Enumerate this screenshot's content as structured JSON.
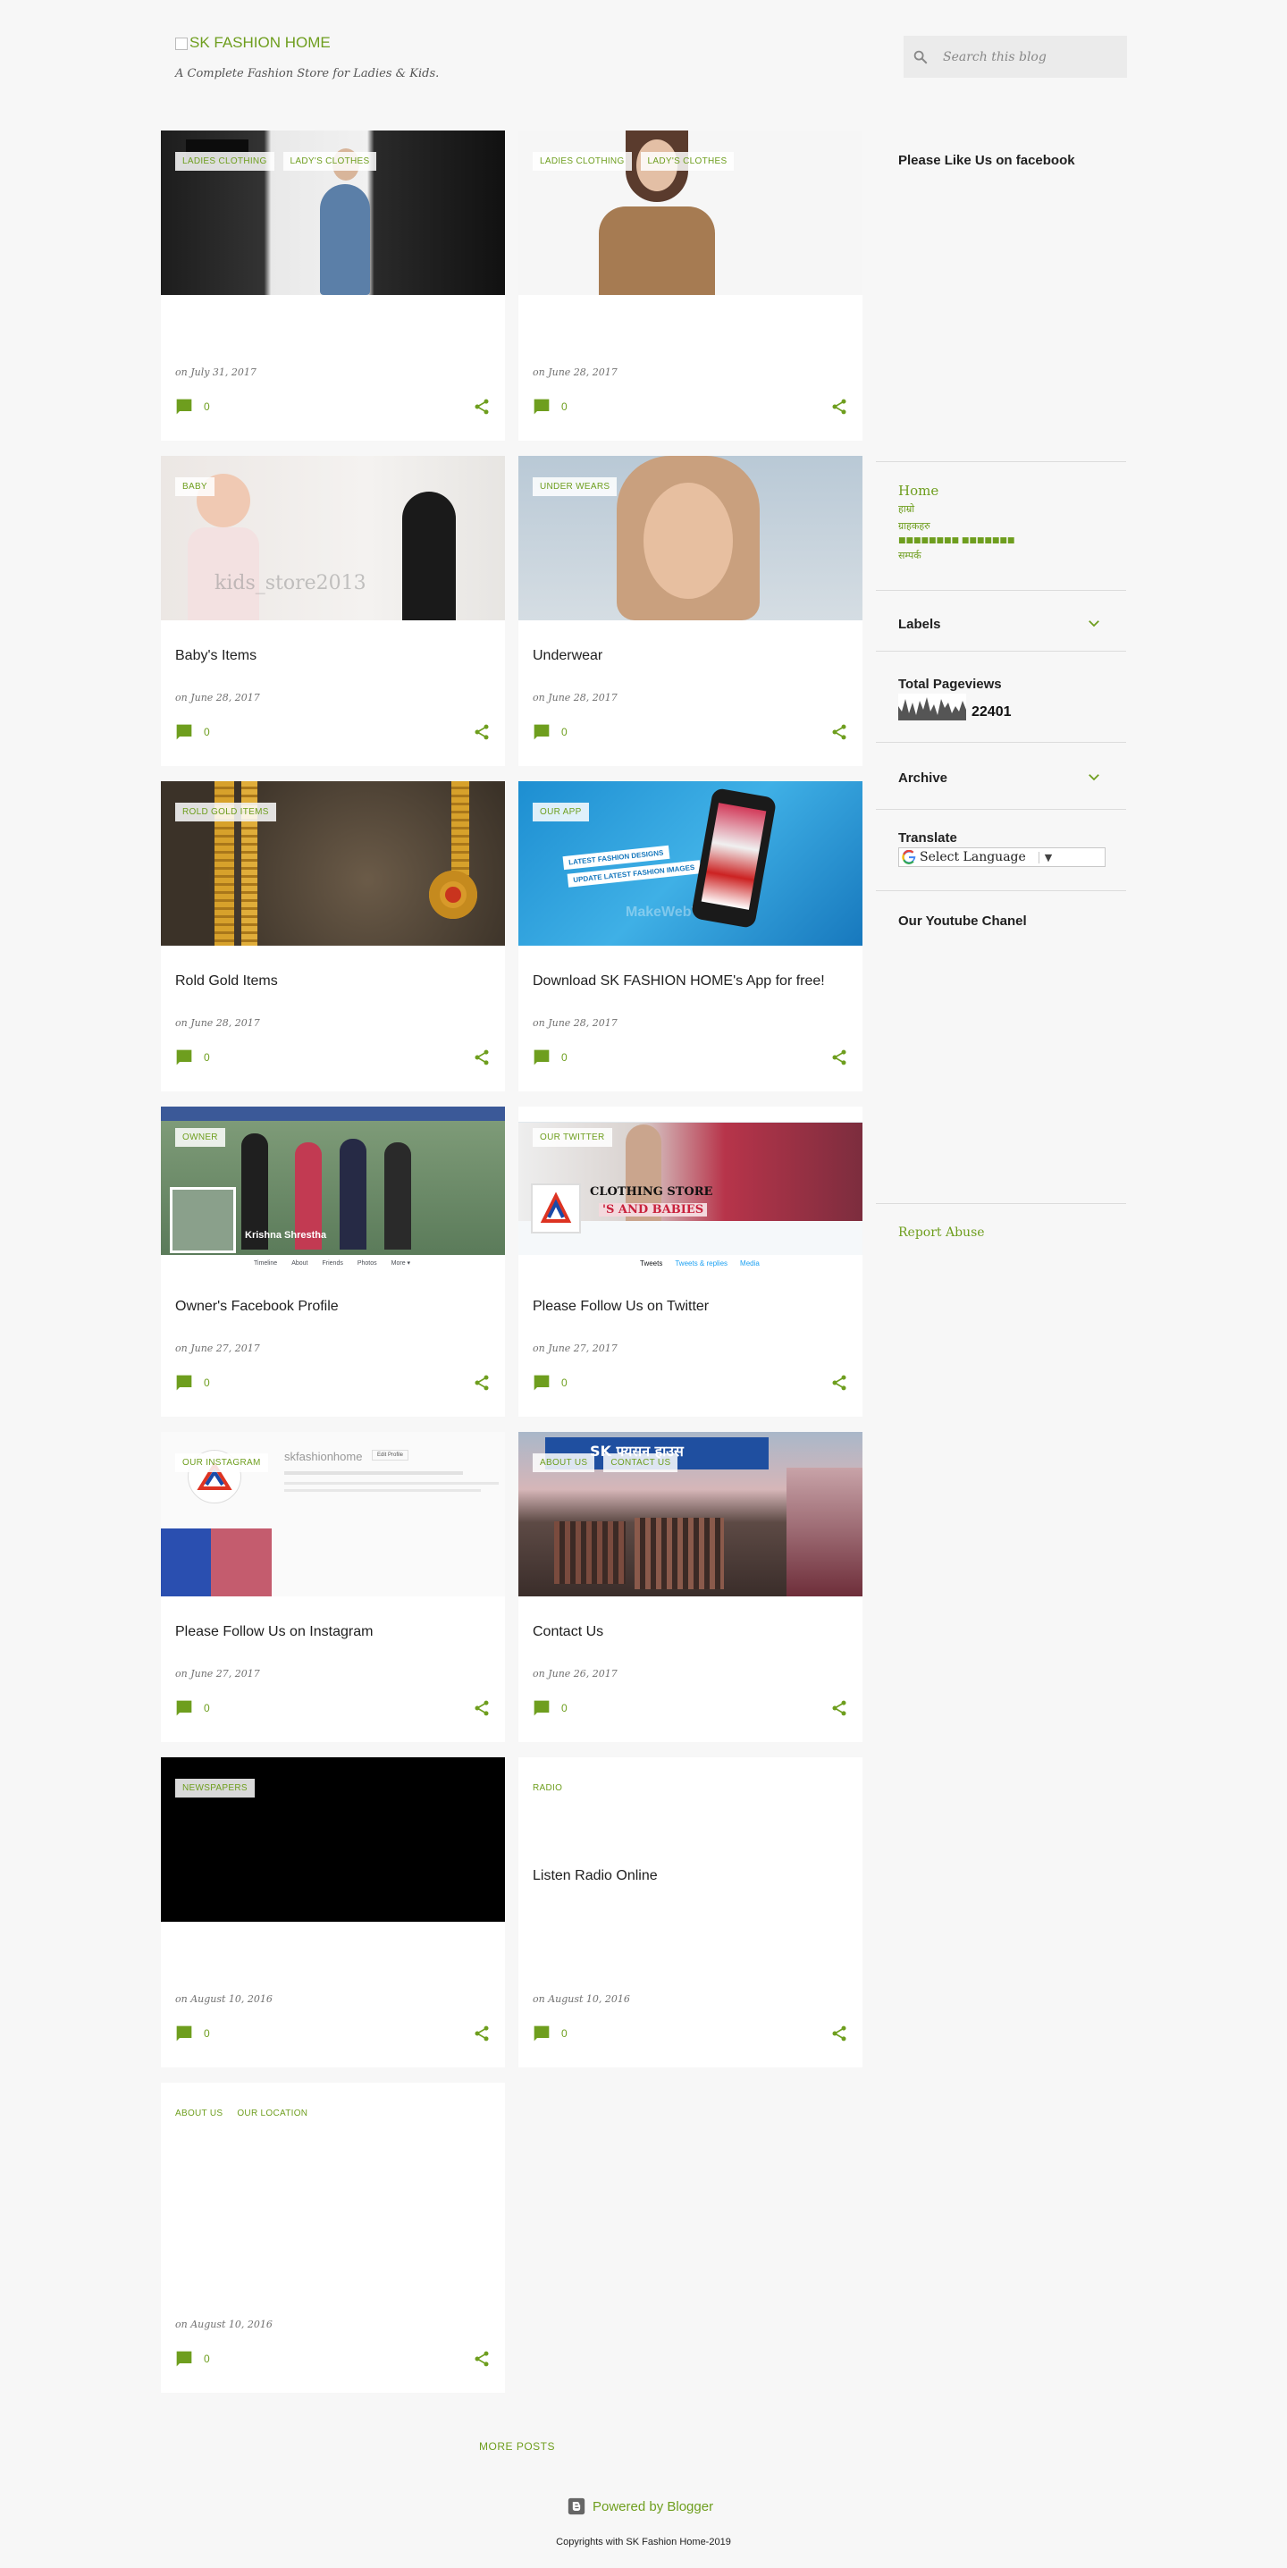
{
  "header": {
    "logo_alt": "SK FASHION HOME",
    "tagline": "A Complete Fashion Store for Ladies & Kids."
  },
  "search": {
    "placeholder": "Search this blog",
    "icon": "search-icon"
  },
  "posts": [
    {
      "labels": [
        "LADIES CLOTHING",
        "LADY'S CLOTHES"
      ],
      "title": "",
      "date": "on July 31, 2017",
      "comments": "0"
    },
    {
      "labels": [
        "LADIES CLOTHING",
        "LADY'S CLOTHES"
      ],
      "title": "",
      "date": "on June 28, 2017",
      "comments": "0"
    },
    {
      "labels": [
        "BABY"
      ],
      "title": "Baby's Items",
      "date": "on June 28, 2017",
      "comments": "0",
      "thumb_text": "kids_store2013"
    },
    {
      "labels": [
        "UNDER WEARS"
      ],
      "title": "Underwear",
      "date": "on June 28, 2017",
      "comments": "0"
    },
    {
      "labels": [
        "ROLD GOLD ITEMS"
      ],
      "title": "Rold Gold Items",
      "date": "on June 28, 2017",
      "comments": "0"
    },
    {
      "labels": [
        "OUR APP"
      ],
      "title": "Download SK FASHION HOME's App for free!",
      "date": "on June 28, 2017",
      "comments": "0",
      "thumb_lines": [
        "LATEST FASHION DESIGNS",
        "UPDATE LATEST FASHION IMAGES",
        "MakeWebV"
      ]
    },
    {
      "labels": [
        "OWNER"
      ],
      "title": "Owner's Facebook Profile",
      "date": "on June 27, 2017",
      "comments": "0",
      "thumb_name": "Krishna Shrestha",
      "thumb_tabs": [
        "Timeline",
        "About",
        "Friends",
        "Photos",
        "More ▾"
      ]
    },
    {
      "labels": [
        "OUR TWITTER"
      ],
      "title": "Please Follow Us on Twitter",
      "date": "on June 27, 2017",
      "comments": "0",
      "thumb_lines": [
        "Clothing Store",
        "'s and Babies",
        "Tweets",
        "Tweets & replies",
        "Media"
      ]
    },
    {
      "labels": [
        "OUR INSTAGRAM"
      ],
      "title": "Please Follow Us on Instagram",
      "date": "on June 27, 2017",
      "comments": "0",
      "thumb_handle": "skfashionhome",
      "thumb_edit": "Edit Profile"
    },
    {
      "labels": [
        "ABOUT US",
        "CONTACT US"
      ],
      "title": "Contact Us",
      "date": "on June 26, 2017",
      "comments": "0",
      "thumb_sign": "SK फ्यसन हाउस"
    },
    {
      "labels": [
        "NEWSPAPERS"
      ],
      "title": "",
      "date": "on August 10, 2016",
      "comments": "0"
    },
    {
      "labels": [
        "RADIO"
      ],
      "title": "Listen Radio Online",
      "date": "on August 10, 2016",
      "comments": "0"
    },
    {
      "labels": [
        "ABOUT US",
        "OUR LOCATION"
      ],
      "title": "",
      "date": "on August 10, 2016",
      "comments": "0"
    }
  ],
  "sidebar": {
    "facebook_title": "Please Like Us on facebook",
    "pages": [
      "Home",
      "हाम्रो",
      "ग्राहकहरु",
      "■■■■■■■■ ■■■■■■■",
      "सम्पर्क"
    ],
    "labels_title": "Labels",
    "pageviews_title": "Total Pageviews",
    "pageviews_count": "22401",
    "archive_title": "Archive",
    "translate_title": "Translate",
    "translate_select": "Select Language",
    "youtube_title": "Our Youtube Chanel",
    "report_abuse": "Report Abuse"
  },
  "footer": {
    "more_posts": "MORE POSTS",
    "powered_by": "Powered by Blogger",
    "copyright": "Copyrights with SK Fashion Home-2019"
  },
  "colors": {
    "accent": "#6e9e1e",
    "background": "#f7f7f7",
    "card": "#ffffff"
  }
}
